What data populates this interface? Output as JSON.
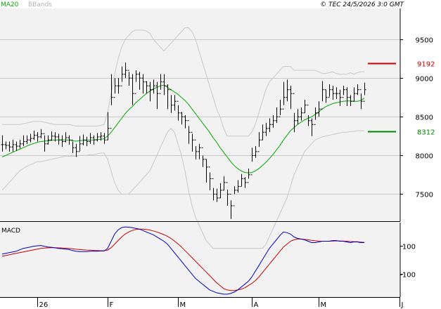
{
  "header": {
    "ma_label": "MA20",
    "bb_label": "BBands",
    "copyright": "© TEC 24/5/2026 3:0 GMT"
  },
  "colors": {
    "background": "#ffffff",
    "panel_bg": "#f2f2f2",
    "candles": "#000000",
    "ma": "#00aa00",
    "bands": "#c8c8c8",
    "resistance": "#cc0000",
    "support": "#008800",
    "macd": "#0000cc",
    "signal": "#cc0000",
    "grid": "#c8c8c8"
  },
  "chart_data": [
    {
      "type": "candlestick",
      "title": "",
      "series_names": [
        "MA20",
        "BBands"
      ],
      "ylim": [
        7150,
        9900
      ],
      "y_ticks": [
        {
          "value": 9500,
          "label": "9500"
        },
        {
          "value": 9000,
          "label": "9000"
        },
        {
          "value": 8500,
          "label": "8500"
        },
        {
          "value": 8000,
          "label": "8000"
        },
        {
          "value": 7500,
          "label": "7500"
        }
      ],
      "x_ticks": [
        {
          "index": 10,
          "label": "26"
        },
        {
          "index": 30,
          "label": "F"
        },
        {
          "index": 50,
          "label": "M"
        },
        {
          "index": 71,
          "label": "A"
        },
        {
          "index": 90,
          "label": "M"
        },
        {
          "index": 113,
          "label": "J"
        }
      ],
      "n_sessions": 114,
      "last_index": 103,
      "levels": [
        {
          "name": "resistance",
          "value": 9192,
          "label": "9192",
          "from_index": 104,
          "to_index": 112
        },
        {
          "name": "support",
          "value": 8312,
          "label": "8312",
          "from_index": 104,
          "to_index": 112
        }
      ],
      "close": [
        8140,
        8130,
        8110,
        8140,
        8120,
        8150,
        8180,
        8200,
        8220,
        8260,
        8240,
        8280,
        8150,
        8200,
        8250,
        8240,
        8200,
        8180,
        8230,
        8200,
        8100,
        8050,
        8150,
        8200,
        8180,
        8230,
        8200,
        8240,
        8250,
        8200,
        8350,
        8750,
        8900,
        8900,
        9050,
        9100,
        9000,
        8800,
        9050,
        9000,
        8950,
        8900,
        8850,
        8900,
        8800,
        8950,
        8900,
        8850,
        8650,
        8700,
        8550,
        8500,
        8450,
        8300,
        8200,
        8050,
        8100,
        7950,
        7850,
        7700,
        7500,
        7450,
        7550,
        7650,
        7500,
        7350,
        7550,
        7600,
        7700,
        7650,
        7750,
        8000,
        8050,
        8200,
        8300,
        8350,
        8400,
        8450,
        8500,
        8600,
        8750,
        8850,
        8800,
        8450,
        8500,
        8550,
        8650,
        8450,
        8400,
        8550,
        8600,
        8850,
        8750,
        8850,
        8800,
        8800,
        8750,
        8850,
        8750,
        8700,
        8800,
        8850,
        8700,
        8850
      ],
      "high": [
        8260,
        8180,
        8180,
        8200,
        8180,
        8200,
        8260,
        8260,
        8280,
        8320,
        8300,
        8340,
        8260,
        8260,
        8310,
        8300,
        8280,
        8260,
        8300,
        8260,
        8180,
        8150,
        8250,
        8270,
        8240,
        8290,
        8260,
        8290,
        8300,
        8290,
        8560,
        9050,
        9000,
        9000,
        9150,
        9200,
        9080,
        9050,
        9100,
        9080,
        9050,
        8960,
        8950,
        8980,
        8950,
        9050,
        9050,
        8920,
        8780,
        8780,
        8650,
        8560,
        8520,
        8380,
        8280,
        8120,
        8150,
        8000,
        7950,
        7780,
        7580,
        7570,
        7640,
        7730,
        7560,
        7420,
        7600,
        7680,
        7760,
        7720,
        7830,
        8100,
        8120,
        8300,
        8400,
        8420,
        8480,
        8520,
        8620,
        8720,
        8950,
        8980,
        8900,
        8550,
        8600,
        8620,
        8720,
        8520,
        8480,
        8620,
        8700,
        8960,
        8850,
        8920,
        8900,
        8880,
        8850,
        8900,
        8880,
        8780,
        8880,
        8920,
        8800,
        8940
      ],
      "low": [
        8050,
        8080,
        8050,
        8050,
        8060,
        8090,
        8120,
        8150,
        8170,
        8200,
        8180,
        8220,
        8050,
        8140,
        8190,
        8180,
        8140,
        8110,
        8170,
        8140,
        8030,
        7980,
        8060,
        8130,
        8120,
        8150,
        8140,
        8180,
        8190,
        8150,
        8200,
        8650,
        8800,
        8800,
        8950,
        9000,
        8900,
        8650,
        8950,
        8850,
        8800,
        8800,
        8700,
        8800,
        8600,
        8850,
        8780,
        8600,
        8550,
        8580,
        8450,
        8400,
        8350,
        8150,
        8050,
        7950,
        7950,
        7850,
        7650,
        7550,
        7420,
        7400,
        7450,
        7550,
        7350,
        7180,
        7500,
        7520,
        7600,
        7580,
        7700,
        7920,
        7970,
        8110,
        8200,
        8250,
        8300,
        8360,
        8420,
        8520,
        8650,
        8700,
        8600,
        8300,
        8400,
        8450,
        8550,
        8380,
        8250,
        8460,
        8500,
        8700,
        8680,
        8760,
        8720,
        8730,
        8640,
        8780,
        8640,
        8640,
        8700,
        8780,
        8600,
        8780
      ],
      "ma20": [
        7980,
        8000,
        8020,
        8040,
        8060,
        8080,
        8100,
        8120,
        8140,
        8155,
        8170,
        8180,
        8185,
        8190,
        8195,
        8198,
        8200,
        8200,
        8200,
        8198,
        8190,
        8185,
        8190,
        8195,
        8195,
        8198,
        8200,
        8205,
        8210,
        8215,
        8250,
        8300,
        8360,
        8420,
        8480,
        8540,
        8590,
        8630,
        8680,
        8720,
        8760,
        8800,
        8830,
        8860,
        8880,
        8900,
        8910,
        8880,
        8850,
        8820,
        8790,
        8750,
        8710,
        8660,
        8600,
        8540,
        8480,
        8420,
        8360,
        8300,
        8230,
        8170,
        8100,
        8040,
        7980,
        7920,
        7870,
        7830,
        7800,
        7780,
        7775,
        7780,
        7800,
        7830,
        7870,
        7910,
        7960,
        8010,
        8070,
        8130,
        8200,
        8260,
        8320,
        8360,
        8400,
        8430,
        8460,
        8480,
        8500,
        8530,
        8560,
        8600,
        8630,
        8650,
        8670,
        8680,
        8690,
        8700,
        8705,
        8705,
        8700,
        8700,
        8710,
        8740
      ],
      "bb_upper": [
        8400,
        8400,
        8400,
        8400,
        8400,
        8400,
        8410,
        8420,
        8430,
        8440,
        8440,
        8440,
        8430,
        8420,
        8410,
        8400,
        8400,
        8400,
        8400,
        8400,
        8390,
        8380,
        8380,
        8380,
        8380,
        8380,
        8380,
        8380,
        8390,
        8400,
        8550,
        8800,
        9050,
        9250,
        9400,
        9500,
        9550,
        9600,
        9620,
        9620,
        9620,
        9610,
        9580,
        9500,
        9450,
        9400,
        9350,
        9400,
        9450,
        9500,
        9550,
        9600,
        9650,
        9650,
        9600,
        9500,
        9350,
        9200,
        9050,
        8900,
        8750,
        8600,
        8500,
        8350,
        8250,
        8250,
        8250,
        8250,
        8250,
        8250,
        8250,
        8300,
        8400,
        8550,
        8700,
        8850,
        8950,
        9000,
        9050,
        9100,
        9150,
        9150,
        9150,
        9100,
        9100,
        9100,
        9100,
        9100,
        9100,
        9100,
        9080,
        9060,
        9060,
        9070,
        9080,
        9060,
        9050,
        9050,
        9050,
        9070,
        9050,
        9070,
        9080,
        9080
      ],
      "bb_lower": [
        7550,
        7600,
        7650,
        7700,
        7750,
        7800,
        7830,
        7860,
        7880,
        7900,
        7920,
        7920,
        7930,
        7940,
        7950,
        7960,
        7970,
        7980,
        7990,
        7990,
        7990,
        7990,
        8000,
        8000,
        8000,
        8010,
        8010,
        8020,
        8030,
        8030,
        7950,
        7800,
        7650,
        7550,
        7500,
        7500,
        7500,
        7550,
        7600,
        7650,
        7700,
        7750,
        7800,
        7900,
        8000,
        8100,
        8200,
        8300,
        8350,
        8300,
        8150,
        8000,
        7800,
        7550,
        7350,
        7200,
        7100,
        7000,
        6900,
        6850,
        6800,
        6800,
        6800,
        6800,
        6800,
        6800,
        6800,
        6800,
        6800,
        6800,
        6800,
        6800,
        6800,
        6800,
        6800,
        6850,
        6950,
        7050,
        7150,
        7250,
        7350,
        7450,
        7600,
        7750,
        7850,
        7950,
        8050,
        8100,
        8150,
        8200,
        8220,
        8240,
        8250,
        8260,
        8270,
        8280,
        8290,
        8300,
        8300,
        8310,
        8310,
        8320,
        8320,
        8320
      ]
    },
    {
      "type": "line",
      "title": "MACD",
      "series_names": [
        "MACD",
        "Signal"
      ],
      "ylim": [
        -260,
        260
      ],
      "y_ticks": [
        {
          "value": 100,
          "label": "100"
        },
        {
          "value": -100,
          "label": "-100"
        }
      ],
      "macd": [
        40,
        45,
        50,
        55,
        60,
        70,
        80,
        85,
        90,
        95,
        98,
        100,
        95,
        90,
        88,
        85,
        80,
        78,
        75,
        72,
        65,
        60,
        58,
        58,
        58,
        60,
        60,
        60,
        62,
        62,
        80,
        130,
        180,
        210,
        225,
        230,
        228,
        225,
        220,
        215,
        205,
        195,
        185,
        175,
        160,
        145,
        130,
        110,
        80,
        50,
        20,
        -10,
        -40,
        -70,
        -100,
        -130,
        -150,
        -170,
        -190,
        -210,
        -220,
        -230,
        -235,
        -240,
        -240,
        -235,
        -225,
        -210,
        -190,
        -170,
        -150,
        -120,
        -80,
        -40,
        0,
        40,
        80,
        110,
        140,
        170,
        195,
        190,
        180,
        160,
        150,
        145,
        140,
        130,
        120,
        120,
        125,
        130,
        130,
        130,
        135,
        135,
        130,
        130,
        125,
        120,
        125,
        125,
        120,
        120
      ],
      "signal": [
        25,
        30,
        35,
        40,
        45,
        50,
        55,
        60,
        65,
        70,
        75,
        80,
        82,
        84,
        85,
        85,
        84,
        83,
        81,
        79,
        77,
        74,
        72,
        70,
        68,
        67,
        66,
        65,
        64,
        64,
        68,
        85,
        110,
        135,
        160,
        180,
        195,
        205,
        212,
        215,
        215,
        212,
        208,
        202,
        195,
        186,
        176,
        165,
        150,
        132,
        112,
        90,
        65,
        40,
        15,
        -10,
        -35,
        -60,
        -85,
        -110,
        -135,
        -160,
        -180,
        -200,
        -210,
        -215,
        -215,
        -210,
        -205,
        -195,
        -180,
        -165,
        -145,
        -120,
        -90,
        -60,
        -30,
        0,
        30,
        60,
        90,
        110,
        130,
        140,
        145,
        145,
        143,
        140,
        136,
        133,
        131,
        130,
        130,
        130,
        131,
        132,
        132,
        131,
        130,
        128,
        127,
        126,
        124,
        122
      ]
    }
  ]
}
